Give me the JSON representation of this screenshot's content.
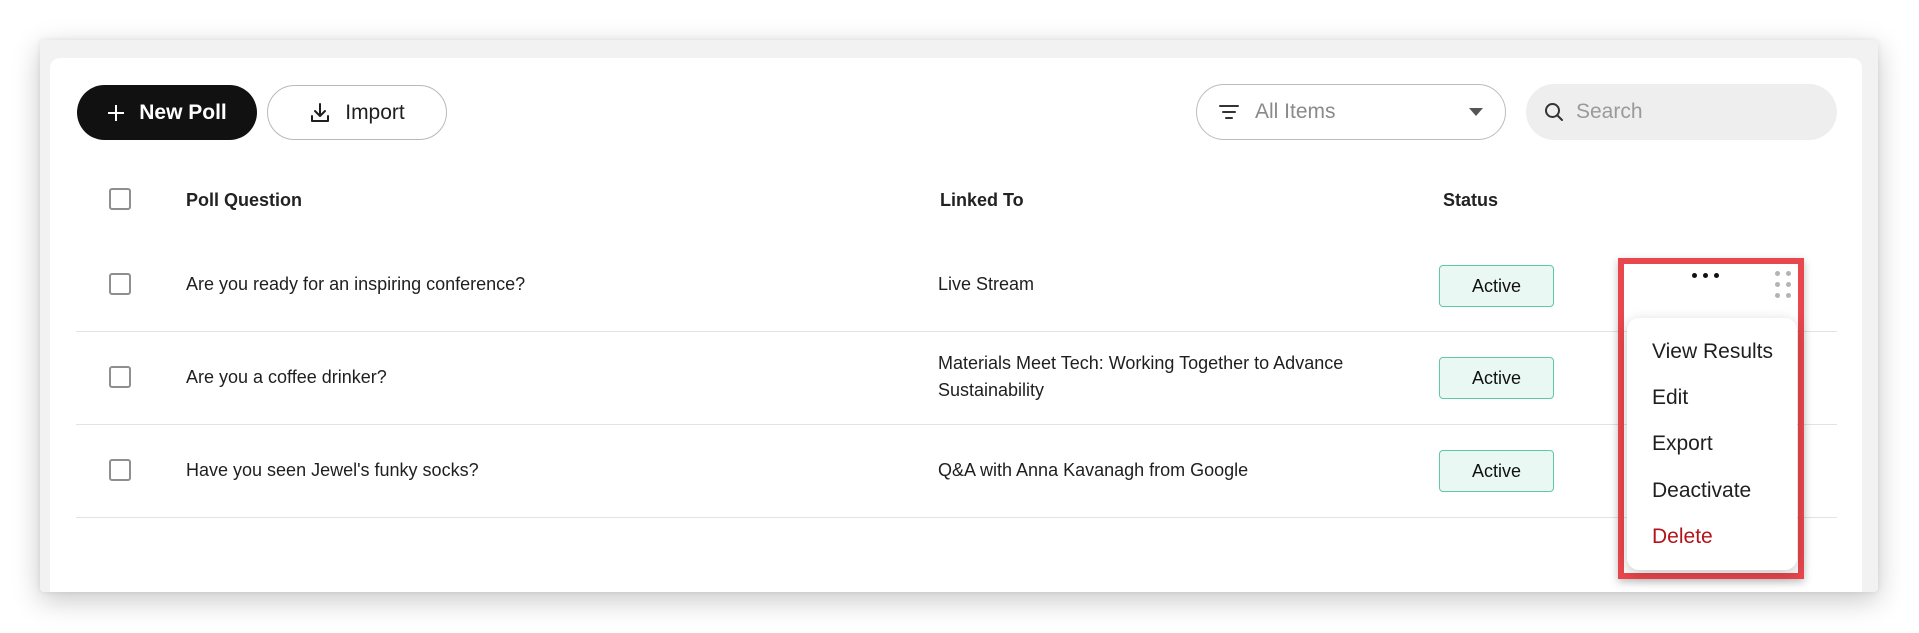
{
  "toolbar": {
    "new_poll_label": "New Poll",
    "import_label": "Import",
    "filter": {
      "selected": "All Items"
    },
    "search": {
      "placeholder": "Search"
    }
  },
  "table": {
    "headers": {
      "question": "Poll Question",
      "linked_to": "Linked To",
      "status": "Status"
    },
    "rows": [
      {
        "question": "Are you ready for an inspiring conference?",
        "linked_to": "Live Stream",
        "status": "Active"
      },
      {
        "question": "Are you a coffee drinker?",
        "linked_to_line1": "Materials Meet Tech: Working Together to Advance",
        "linked_to_line2": "Sustainability",
        "status": "Active"
      },
      {
        "question": "Have you seen Jewel's funky socks?",
        "linked_to": "Q&A with Anna Kavanagh from Google",
        "status": "Active"
      }
    ]
  },
  "row_menu": {
    "items": [
      "View Results",
      "Edit",
      "Export",
      "Deactivate",
      "Delete"
    ]
  },
  "colors": {
    "primary_button": "#111111",
    "active_badge_bg": "#e9f8f3",
    "active_badge_border": "#5fc9a4",
    "delete_text": "#b3141c",
    "highlight_border": "#e8474d"
  },
  "icons": {
    "new_poll": "plus-icon",
    "import": "download-icon",
    "filter": "filter-lines-icon",
    "dropdown": "caret-down-icon",
    "search": "search-icon",
    "row_actions": "more-horizontal-icon",
    "drag": "drag-handle-icon"
  }
}
